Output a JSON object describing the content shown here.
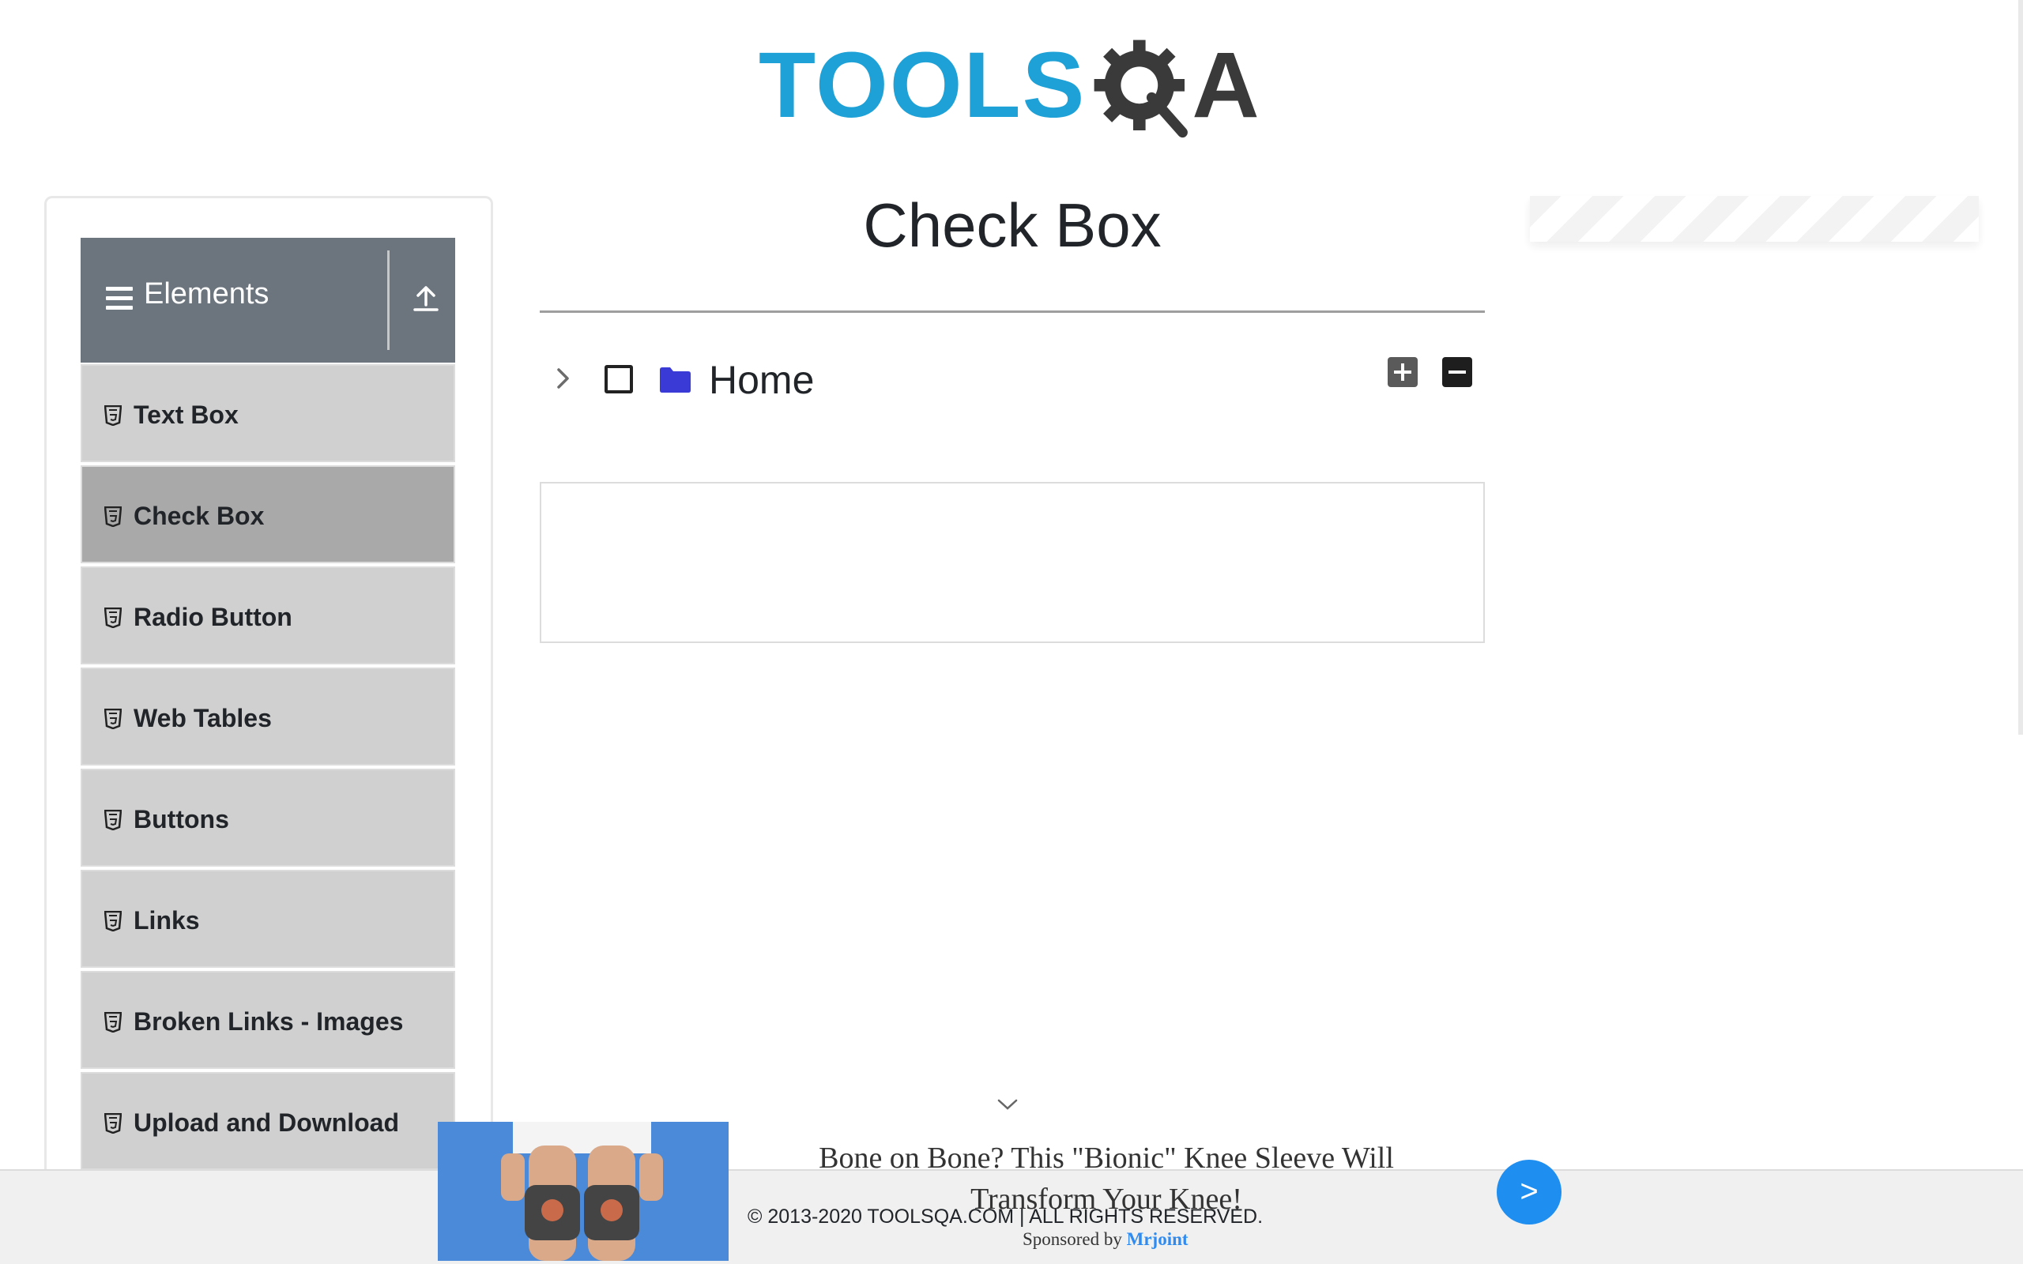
{
  "logo": {
    "text_blue": "TOOLS",
    "text_dark": "A",
    "colors": {
      "blue": "#1da1d6",
      "dark": "#3a3a3a"
    }
  },
  "sidebar": {
    "group_title": "Elements",
    "items": [
      {
        "label": "Text Box",
        "active": false
      },
      {
        "label": "Check Box",
        "active": true
      },
      {
        "label": "Radio Button",
        "active": false
      },
      {
        "label": "Web Tables",
        "active": false
      },
      {
        "label": "Buttons",
        "active": false
      },
      {
        "label": "Links",
        "active": false
      },
      {
        "label": "Broken Links - Images",
        "active": false
      },
      {
        "label": "Upload and Download",
        "active": false
      }
    ]
  },
  "main": {
    "title": "Check Box",
    "tree": {
      "root_label": "Home",
      "checked": false,
      "expanded": false,
      "folder_color": "#3a3ad6"
    }
  },
  "footer": {
    "copyright": "© 2013-2020 TOOLSQA.COM | ALL RIGHTS RESERVED."
  },
  "ad": {
    "headline": "Bone on Bone? This \"Bionic\" Knee Sleeve Will Transform Your Knee!",
    "sponsored_prefix": "Sponsored by",
    "sponsor": "Mrjoint",
    "next_label": ">"
  }
}
